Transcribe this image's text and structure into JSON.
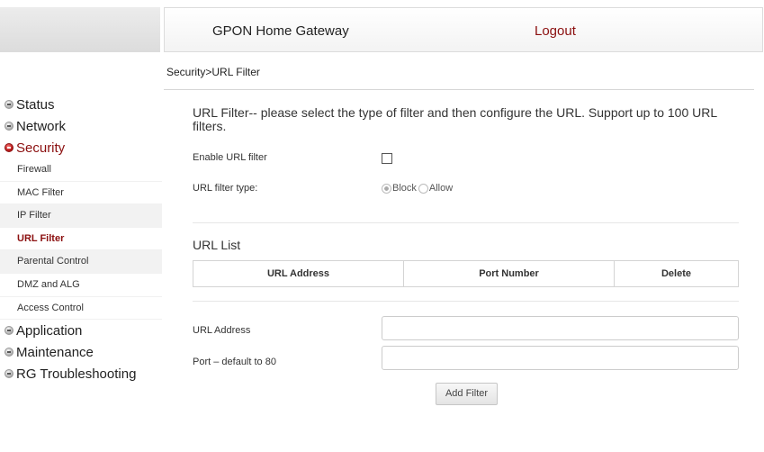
{
  "header": {
    "title": "GPON Home Gateway",
    "logout_label": "Logout"
  },
  "breadcrumb": "Security>URL Filter",
  "sidebar": {
    "status": "Status",
    "network": "Network",
    "security": "Security",
    "security_items": [
      "Firewall",
      "MAC Filter",
      "IP Filter",
      "URL Filter",
      "Parental Control",
      "DMZ and ALG",
      "Access Control"
    ],
    "application": "Application",
    "maintenance": "Maintenance",
    "rg_troubleshooting": "RG Troubleshooting"
  },
  "main": {
    "description": "URL Filter-- please select the type of filter and then configure the URL. Support up to 100 URL filters.",
    "enable_label": "Enable URL filter",
    "enable_checked": false,
    "filter_type_label": "URL filter type:",
    "filter_type_options": [
      "Block",
      "Allow"
    ],
    "filter_type_selected": "Block",
    "url_list_title": "URL List",
    "table_headers": [
      "URL Address",
      "Port Number",
      "Delete"
    ],
    "url_address_label": "URL Address",
    "url_address_value": "",
    "port_label": "Port – default to 80",
    "port_value": "",
    "add_filter_label": "Add Filter"
  }
}
